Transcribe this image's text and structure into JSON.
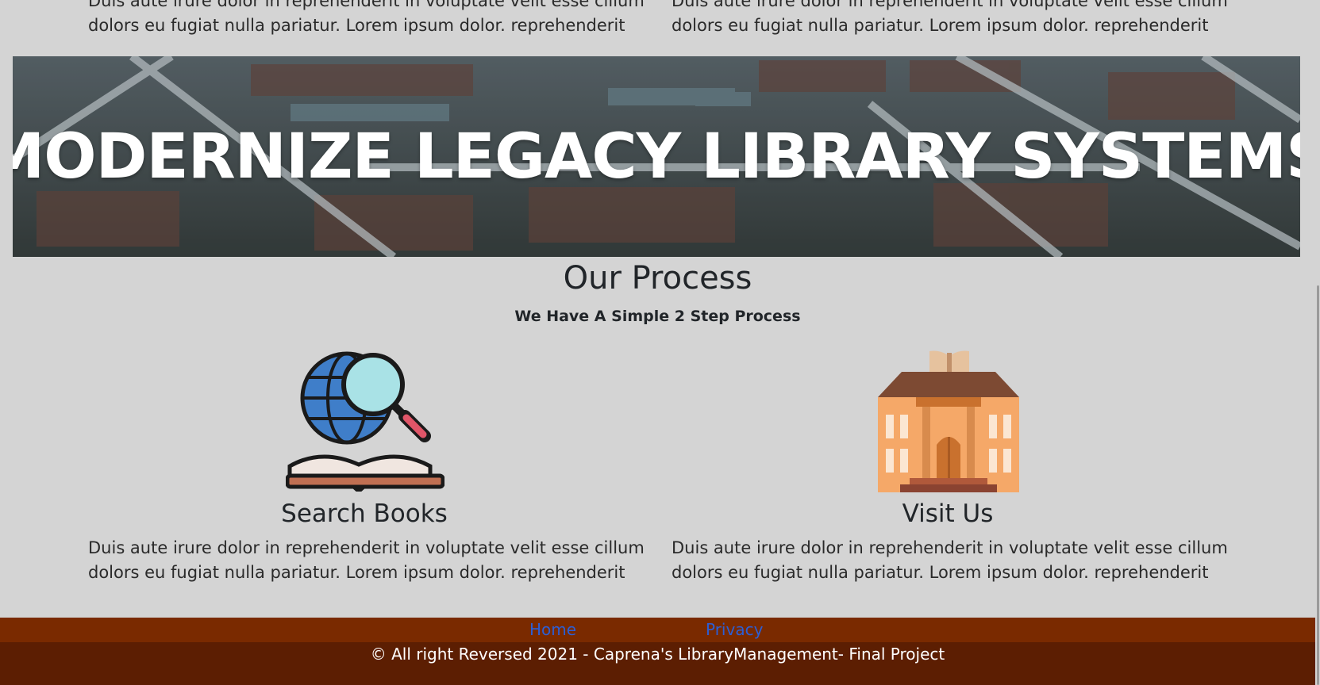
{
  "intro": {
    "left_text": "Duis aute irure dolor in reprehenderit in voluptate velit esse cillum dolors eu fugiat nulla pariatur. Lorem ipsum dolor. reprehenderit",
    "right_text": "Duis aute irure dolor in reprehenderit in voluptate velit esse cillum dolors eu fugiat nulla pariatur. Lorem ipsum dolor. reprehenderit"
  },
  "banner": {
    "title": "MODERNIZE LEGACY LIBRARY SYSTEMS"
  },
  "process": {
    "title": "Our Process",
    "subtitle": "We Have A Simple 2 Step Process",
    "steps": [
      {
        "icon": "globe-search-book-icon",
        "title": "Search Books",
        "text": "Duis aute irure dolor in reprehenderit in voluptate velit esse cillum dolors eu fugiat nulla pariatur. Lorem ipsum dolor. reprehenderit"
      },
      {
        "icon": "library-building-icon",
        "title": "Visit Us",
        "text": "Duis aute irure dolor in reprehenderit in voluptate velit esse cillum dolors eu fugiat nulla pariatur. Lorem ipsum dolor. reprehenderit"
      }
    ]
  },
  "footer": {
    "nav": {
      "home": "Home",
      "privacy": "Privacy"
    },
    "copyright": "© All right Reversed 2021 - Caprena's LibraryManagement- Final Project",
    "colors": {
      "nav_bg": "#7a2a00",
      "bottom_bg": "#5c1e02",
      "link": "#2b5fd6"
    }
  }
}
